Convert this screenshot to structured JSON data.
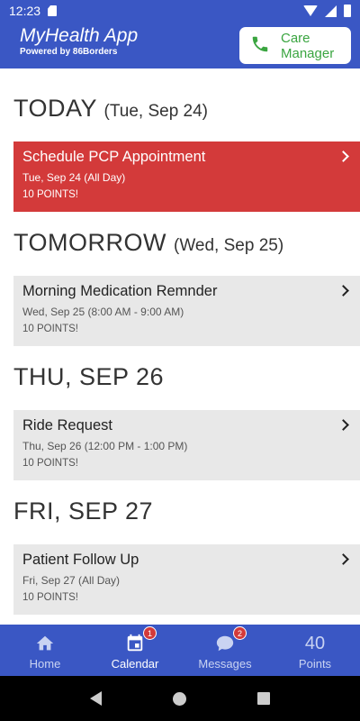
{
  "status_bar": {
    "time": "12:23"
  },
  "header": {
    "title": "MyHealth App",
    "subtitle": "Powered by 86Borders",
    "care_manager_label": "Care Manager"
  },
  "days": [
    {
      "heading": "TODAY",
      "sub": "(Tue, Sep 24)",
      "event": {
        "title": "Schedule PCP Appointment",
        "date": "Tue, Sep 24 (All Day)",
        "points": "10 POINTS!",
        "urgent": true
      }
    },
    {
      "heading": "TOMORROW",
      "sub": "(Wed, Sep 25)",
      "event": {
        "title": "Morning Medication Remnder",
        "date": "Wed, Sep 25 (8:00 AM - 9:00 AM)",
        "points": "10 POINTS!",
        "urgent": false
      }
    },
    {
      "heading": "THU, SEP 26",
      "sub": "",
      "event": {
        "title": "Ride Request",
        "date": "Thu, Sep 26 (12:00 PM - 1:00 PM)",
        "points": "10 POINTS!",
        "urgent": false
      }
    },
    {
      "heading": "FRI, SEP 27",
      "sub": "",
      "event": {
        "title": "Patient Follow Up",
        "date": "Fri, Sep 27 (All Day)",
        "points": "10 POINTS!",
        "urgent": false
      }
    }
  ],
  "bottom_nav": {
    "home": {
      "label": "Home",
      "icon": "home-icon"
    },
    "calendar": {
      "label": "Calendar",
      "icon": "calendar-icon",
      "badge": "1"
    },
    "messages": {
      "label": "Messages",
      "icon": "chat-icon",
      "badge": "2"
    },
    "points": {
      "label": "Points",
      "value": "40"
    }
  },
  "colors": {
    "primary": "#3a57c4",
    "urgent": "#d33a3a",
    "card": "#e8e8e8",
    "care_manager_green": "#3aa540"
  }
}
